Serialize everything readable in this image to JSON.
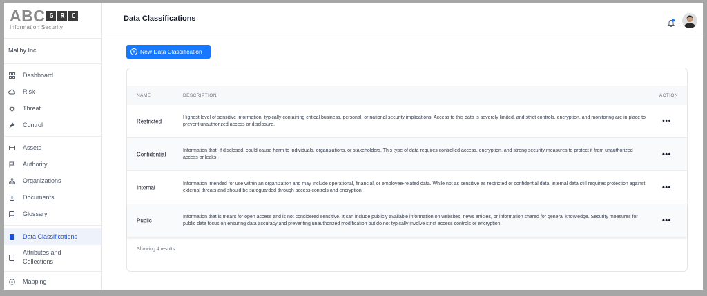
{
  "logo": {
    "main": "ABC",
    "boxes": [
      "G",
      "R",
      "C"
    ],
    "sub": "Information Security"
  },
  "org_name": "Mallby Inc.",
  "sidebar": {
    "items": [
      {
        "label": "Dashboard",
        "icon": "grid-icon"
      },
      {
        "label": "Risk",
        "icon": "cloud-icon"
      },
      {
        "label": "Threat",
        "icon": "bug-icon"
      },
      {
        "label": "Control",
        "icon": "pin-icon"
      },
      {
        "label": "Assets",
        "icon": "briefcase-icon"
      },
      {
        "label": "Authority",
        "icon": "flag-icon"
      },
      {
        "label": "Organizations",
        "icon": "org-icon"
      },
      {
        "label": "Documents",
        "icon": "document-icon"
      },
      {
        "label": "Glossary",
        "icon": "book-icon"
      },
      {
        "label": "Data Classifications",
        "icon": "bookmark-icon"
      },
      {
        "label": "Attributes and",
        "label2": "Collections",
        "icon": "tag-icon"
      },
      {
        "label": "Mapping",
        "icon": "target-icon"
      }
    ]
  },
  "header": {
    "title": "Data Classifications"
  },
  "toolbar": {
    "new_label": "New Data Classification"
  },
  "table": {
    "columns": {
      "name": "NAME",
      "description": "DESCRIPTION",
      "action": "ACTION"
    },
    "rows": [
      {
        "name": "Restricted",
        "description": "Highest level of sensitive information, typically containing critical business, personal, or national security implications. Access to this data is severely limited, and strict controls, encryption, and monitoring are in place to prevent unauthorized access or disclosure.",
        "action": "•••"
      },
      {
        "name": "Confidential",
        "description": "Information that, if disclosed, could cause harm to individuals, organizations, or stakeholders. This type of data requires controlled access, encryption, and strong security measures to protect it from unauthorized access or leaks",
        "action": "•••"
      },
      {
        "name": "Internal",
        "description": "Information intended for use within an organization and may include operational, financial, or employee-related data. While not as sensitive as restricted or confidential data, internal data still requires protection against external threats and should be safeguarded through access controls and encryption",
        "action": "•••"
      },
      {
        "name": "Public",
        "description": "Information that is meant for open access and is not considered sensitive. It can include publicly available information on websites, news articles, or information shared for general knowledge. Security measures for public data focus on ensuring data accuracy and preventing unauthorized modification but do not typically involve strict access controls or encryption.",
        "action": "•••"
      }
    ],
    "footer": "Showing 4 results"
  },
  "colors": {
    "accent": "#1677ff",
    "active_bg": "#eef3fb",
    "active_text": "#1d4ed8"
  }
}
